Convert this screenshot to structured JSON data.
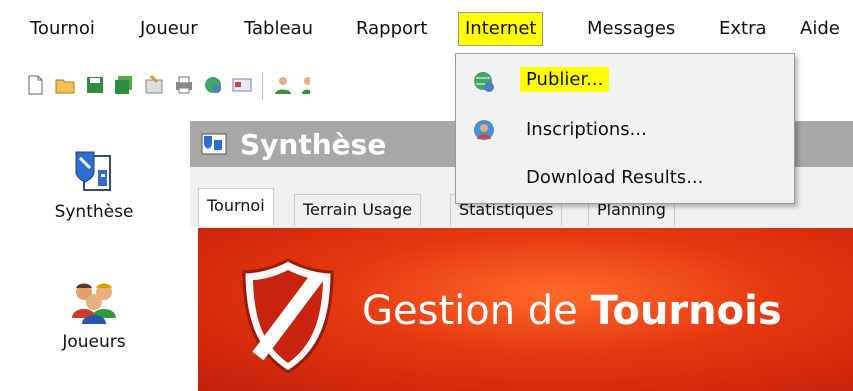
{
  "menubar": {
    "items": [
      {
        "label": "Tournoi"
      },
      {
        "label": "Joueur"
      },
      {
        "label": "Tableau"
      },
      {
        "label": "Rapport"
      },
      {
        "label": "Internet"
      },
      {
        "label": "Messages"
      },
      {
        "label": "Extra"
      },
      {
        "label": "Aide"
      }
    ]
  },
  "internet_menu": {
    "items": [
      {
        "label": "Publier...",
        "icon": "globe-publish-icon"
      },
      {
        "label": "Inscriptions...",
        "icon": "globe-person-icon"
      },
      {
        "label": "Download Results..."
      }
    ]
  },
  "sidebar": {
    "items": [
      {
        "label": "Synthèse",
        "icon": "summary-document-icon"
      },
      {
        "label": "Joueurs",
        "icon": "players-group-icon"
      }
    ]
  },
  "main": {
    "title": "Synthèse",
    "tabs": [
      {
        "label": "Tournoi"
      },
      {
        "label": "Terrain Usage"
      },
      {
        "label": "Statistiques"
      },
      {
        "label": "Planning"
      }
    ],
    "banner": {
      "text_light": "Gestion de ",
      "text_bold": "Tournois"
    }
  },
  "colors": {
    "highlight": "#ffff00",
    "header_bar": "#a8a8a8",
    "banner_red": "#d92a10"
  }
}
